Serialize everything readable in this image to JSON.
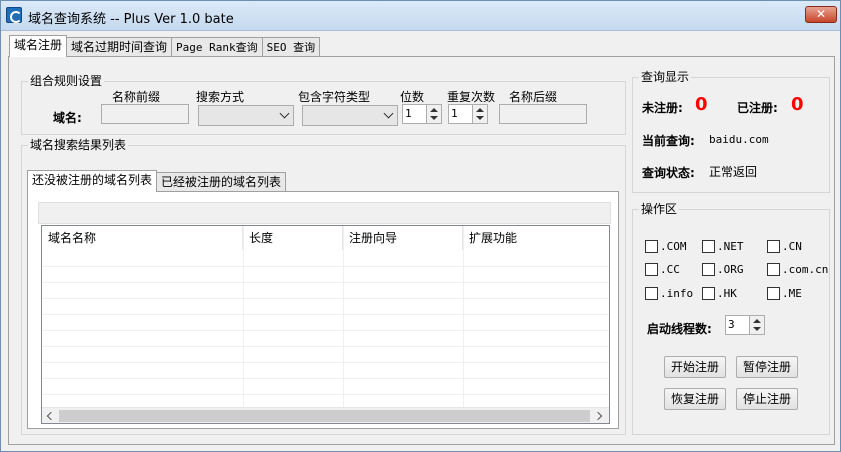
{
  "window": {
    "title": "域名查询系统 -- Plus Ver 1.0 bate",
    "close_label": "✕"
  },
  "main_tabs": [
    {
      "label": "域名注册",
      "active": true
    },
    {
      "label": "域名过期时间查询",
      "active": false
    },
    {
      "label": "Page Rank查询",
      "active": false
    },
    {
      "label": "SEO 查询",
      "active": false
    }
  ],
  "rules": {
    "group_title": "组合规则设置",
    "domain_label": "域名:",
    "prefix_label": "名称前缀",
    "prefix_value": "",
    "search_mode_label": "搜索方式",
    "search_mode_value": "",
    "char_type_label": "包含字符类型",
    "char_type_value": "",
    "digits_label": "位数",
    "digits_value": "1",
    "repeat_label": "重复次数",
    "repeat_value": "1",
    "suffix_label": "名称后缀",
    "suffix_value": ""
  },
  "results": {
    "group_title": "域名搜索结果列表",
    "tabs": [
      {
        "label": "还没被注册的域名列表",
        "active": true
      },
      {
        "label": "已经被注册的域名列表",
        "active": false
      }
    ],
    "columns": [
      "域名名称",
      "长度",
      "注册向导",
      "扩展功能"
    ],
    "rows": []
  },
  "query_display": {
    "group_title": "查询显示",
    "unregistered_label": "未注册:",
    "unregistered_count": "0",
    "registered_label": "已注册:",
    "registered_count": "0",
    "current_query_label": "当前查询:",
    "current_query_value": "baidu.com",
    "status_label": "查询状态:",
    "status_value": "正常返回",
    "count_color": "#ff0000"
  },
  "operations": {
    "group_title": "操作区",
    "tlds": [
      ".COM",
      ".NET",
      ".CN",
      ".CC",
      ".ORG",
      ".com.cn",
      ".info",
      ".HK",
      ".ME"
    ],
    "threads_label": "启动线程数:",
    "threads_value": "3",
    "start_label": "开始注册",
    "pause_label": "暂停注册",
    "resume_label": "恢复注册",
    "stop_label": "停止注册"
  }
}
